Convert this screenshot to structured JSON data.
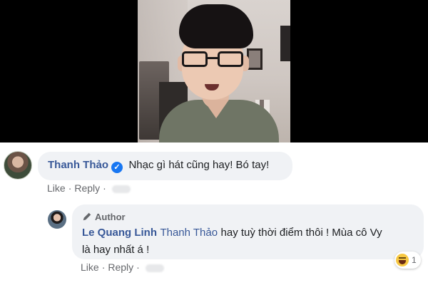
{
  "comments": [
    {
      "author": "Thanh Thảo",
      "verified": true,
      "text": "Nhạc gì hát cũng hay! Bó tay!",
      "actions": {
        "like": "Like",
        "reply": "Reply"
      }
    },
    {
      "author_badge": "Author",
      "author": "Le Quang Linh",
      "mention": "Thanh Thảo",
      "text_line1": "hay tuỳ thời điểm thôi ! Mùa cô Vy",
      "text_line2": "là hay nhất á !",
      "reaction": {
        "icon": "haha-reaction-icon",
        "count": "1"
      },
      "actions": {
        "like": "Like",
        "reply": "Reply"
      }
    }
  ],
  "colors": {
    "name": "#385898",
    "bubble": "#f0f2f5",
    "meta": "#65676b",
    "verified": "#1877f2"
  }
}
